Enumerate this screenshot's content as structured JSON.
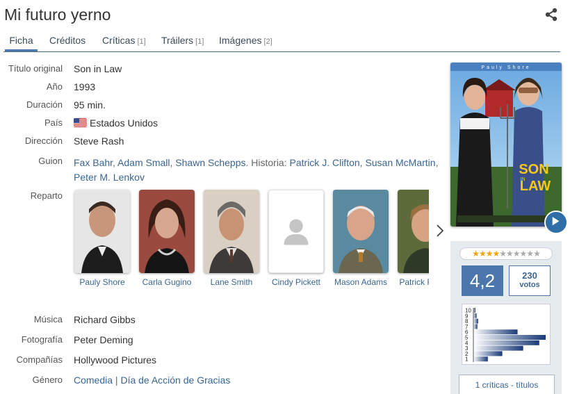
{
  "page": {
    "title": "Mi futuro yerno"
  },
  "tabs": [
    {
      "label": "Ficha",
      "count": ""
    },
    {
      "label": "Créditos",
      "count": ""
    },
    {
      "label": "Críticas",
      "count": "[1]"
    },
    {
      "label": "Tráilers",
      "count": "[1]"
    },
    {
      "label": "Imágenes",
      "count": "[2]"
    }
  ],
  "fields": {
    "original_title": {
      "label": "Título original",
      "value": "Son in Law"
    },
    "year": {
      "label": "Año",
      "value": "1993"
    },
    "duration": {
      "label": "Duración",
      "value": "95 min."
    },
    "country": {
      "label": "País",
      "value": "Estados Unidos"
    },
    "direction": {
      "label": "Dirección",
      "value": "Steve Rash"
    },
    "script": {
      "label": "Guion",
      "writers": [
        "Fax Bahr",
        "Adam Small",
        "Shawn Schepps"
      ],
      "story_prefix": "Historia:",
      "story": [
        "Patrick J. Clifton",
        "Susan McMartin",
        "Peter M. Lenkov"
      ]
    },
    "cast": {
      "label": "Reparto"
    },
    "music": {
      "label": "Música",
      "value": "Richard Gibbs"
    },
    "photography": {
      "label": "Fotografía",
      "value": "Peter Deming"
    },
    "companies": {
      "label": "Compañías",
      "value": "Hollywood Pictures"
    },
    "genre": {
      "label": "Género",
      "values": [
        "Comedia",
        "Día de Acción de Gracias"
      ],
      "separator": "|"
    }
  },
  "cast": [
    {
      "name": "Pauly Shore"
    },
    {
      "name": "Carla Gugino"
    },
    {
      "name": "Lane Smith"
    },
    {
      "name": "Cindy Pickett"
    },
    {
      "name": "Mason Adams"
    },
    {
      "name": "Patrick Renna"
    }
  ],
  "poster": {
    "top_text": "Pauly Shore",
    "title_line1": "SON",
    "title_line2": "LAW",
    "title_in": "IN"
  },
  "rating": {
    "average": "4,2",
    "votes": "230",
    "votes_label": "votos",
    "stars": 4,
    "max_stars": 10,
    "histogram": {
      "labels": [
        "10",
        "9",
        "8",
        "7",
        "6",
        "5",
        "4",
        "3",
        "2",
        "1"
      ],
      "values": [
        2,
        4,
        6,
        5,
        55,
        90,
        82,
        62,
        36,
        18
      ]
    },
    "critics_link": "1 críticas - títulos"
  },
  "colors": {
    "link": "#3a6593",
    "accent": "#4b77ad",
    "tab_line": "#4a6a8a"
  },
  "icons": {
    "share": "share-icon",
    "next": "chevron-right-icon",
    "play": "play-icon",
    "placeholder": "user-placeholder-icon",
    "flag": "us-flag-icon"
  }
}
